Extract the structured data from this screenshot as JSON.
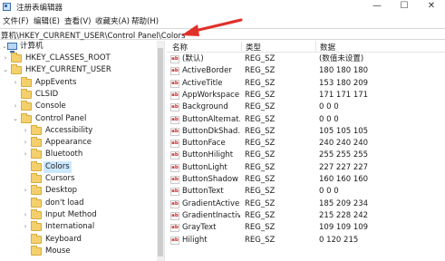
{
  "window": {
    "title": "注册表编辑器",
    "minimize": "—",
    "maximize": "☐",
    "close": "✕"
  },
  "menu": [
    "文件(F)",
    "编辑(E)",
    "查看(V)",
    "收藏夹(A)",
    "帮助(H)"
  ],
  "address": "算机\\HKEY_CURRENT_USER\\Control Panel\\Colors",
  "tree": {
    "root": "计算机",
    "items": [
      {
        "label": "HKEY_CLASSES_ROOT",
        "depth": 1,
        "expander": "›",
        "selected": false
      },
      {
        "label": "HKEY_CURRENT_USER",
        "depth": 1,
        "expander": "⌄",
        "selected": false
      },
      {
        "label": "AppEvents",
        "depth": 2,
        "expander": "›",
        "selected": false
      },
      {
        "label": "CLSID",
        "depth": 2,
        "expander": "",
        "selected": false
      },
      {
        "label": "Console",
        "depth": 2,
        "expander": "›",
        "selected": false
      },
      {
        "label": "Control Panel",
        "depth": 2,
        "expander": "⌄",
        "selected": false
      },
      {
        "label": "Accessibility",
        "depth": 3,
        "expander": "›",
        "selected": false
      },
      {
        "label": "Appearance",
        "depth": 3,
        "expander": "›",
        "selected": false
      },
      {
        "label": "Bluetooth",
        "depth": 3,
        "expander": "›",
        "selected": false
      },
      {
        "label": "Colors",
        "depth": 3,
        "expander": "",
        "selected": true
      },
      {
        "label": "Cursors",
        "depth": 3,
        "expander": "",
        "selected": false
      },
      {
        "label": "Desktop",
        "depth": 3,
        "expander": "›",
        "selected": false
      },
      {
        "label": "don't load",
        "depth": 3,
        "expander": "",
        "selected": false
      },
      {
        "label": "Input Method",
        "depth": 3,
        "expander": "›",
        "selected": false
      },
      {
        "label": "International",
        "depth": 3,
        "expander": "›",
        "selected": false
      },
      {
        "label": "Keyboard",
        "depth": 3,
        "expander": "",
        "selected": false
      },
      {
        "label": "Mouse",
        "depth": 3,
        "expander": "",
        "selected": false
      }
    ]
  },
  "columns": {
    "name": "名称",
    "type": "类型",
    "data": "数据"
  },
  "values": [
    {
      "name": "(默认)",
      "type": "REG_SZ",
      "data": "(数值未设置)"
    },
    {
      "name": "ActiveBorder",
      "type": "REG_SZ",
      "data": "180 180 180"
    },
    {
      "name": "ActiveTitle",
      "type": "REG_SZ",
      "data": "153 180 209"
    },
    {
      "name": "AppWorkspace",
      "type": "REG_SZ",
      "data": "171 171 171"
    },
    {
      "name": "Background",
      "type": "REG_SZ",
      "data": "0 0 0"
    },
    {
      "name": "ButtonAlternat...",
      "type": "REG_SZ",
      "data": "0 0 0"
    },
    {
      "name": "ButtonDkShad...",
      "type": "REG_SZ",
      "data": "105 105 105"
    },
    {
      "name": "ButtonFace",
      "type": "REG_SZ",
      "data": "240 240 240"
    },
    {
      "name": "ButtonHilight",
      "type": "REG_SZ",
      "data": "255 255 255"
    },
    {
      "name": "ButtonLight",
      "type": "REG_SZ",
      "data": "227 227 227"
    },
    {
      "name": "ButtonShadow",
      "type": "REG_SZ",
      "data": "160 160 160"
    },
    {
      "name": "ButtonText",
      "type": "REG_SZ",
      "data": "0 0 0"
    },
    {
      "name": "GradientActive...",
      "type": "REG_SZ",
      "data": "185 209 234"
    },
    {
      "name": "GradientInactiv...",
      "type": "REG_SZ",
      "data": "215 228 242"
    },
    {
      "name": "GrayText",
      "type": "REG_SZ",
      "data": "109 109 109"
    },
    {
      "name": "Hilight",
      "type": "REG_SZ",
      "data": "0 120 215"
    }
  ],
  "value_icon": "ab",
  "colors": {
    "arrow": "#e0302a",
    "selection": "#cce8ff",
    "folder": "#f4d06d"
  }
}
